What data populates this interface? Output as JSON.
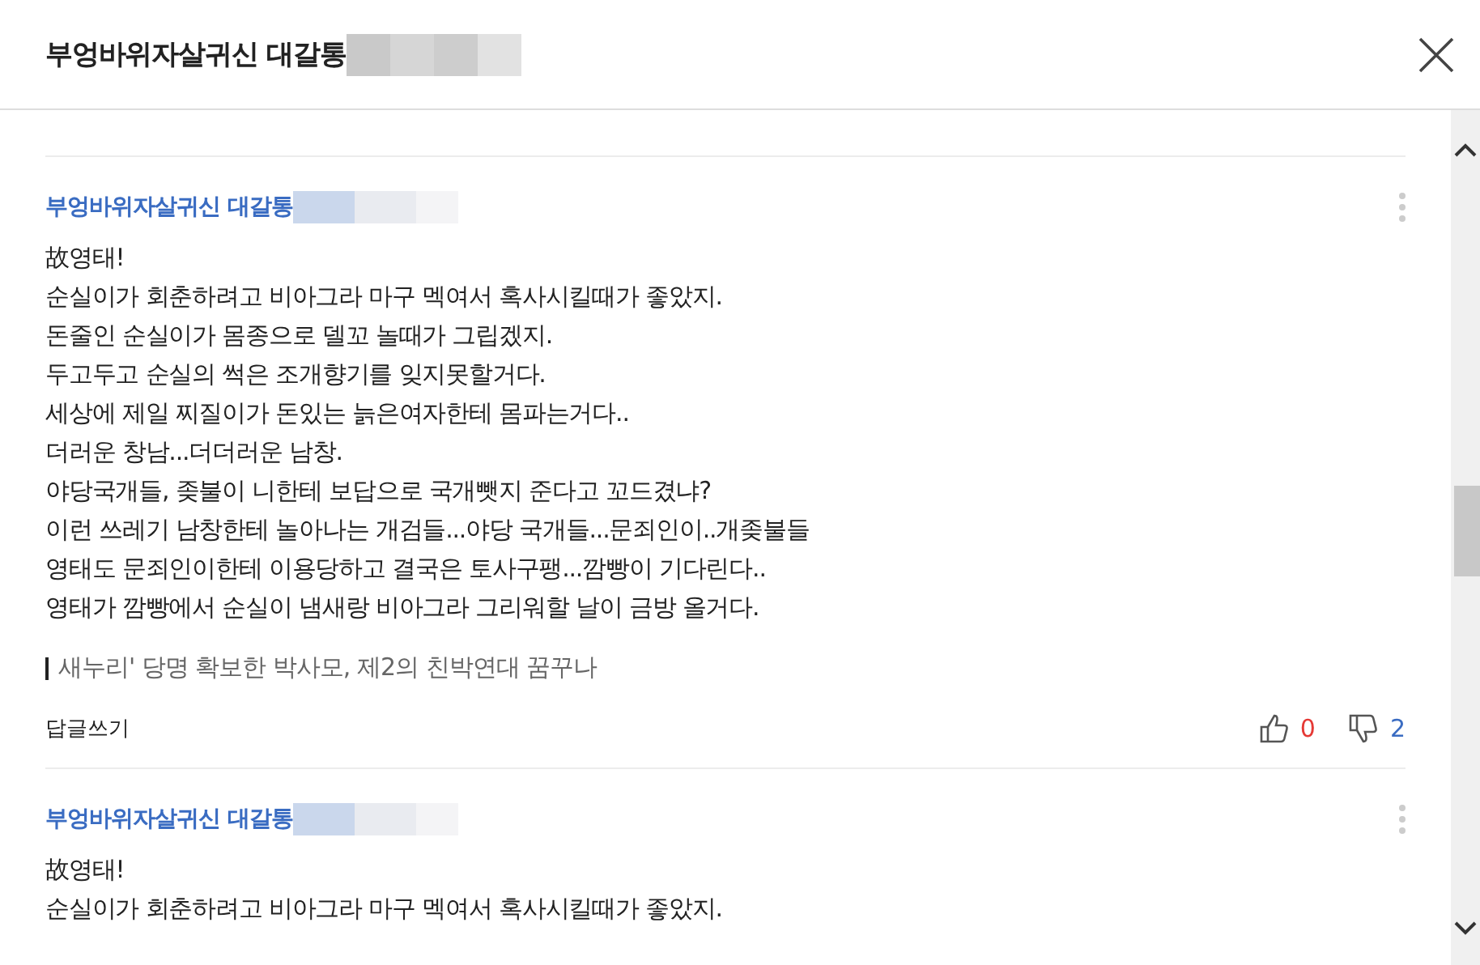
{
  "window": {
    "title": "부엉바위자살귀신 대갈통"
  },
  "comments": [
    {
      "author": "부엉바위자살귀신 대갈통",
      "body_lines": [
        "故영태!",
        "순실이가 회춘하려고 비아그라 마구 멕여서 혹사시킬때가 좋았지.",
        "돈줄인 순실이가 몸종으로 델꼬 놀때가 그립겠지.",
        "두고두고 순실의 썩은 조개향기를 잊지못할거다.",
        "세상에 제일 찌질이가 돈있는 늙은여자한테 몸파는거다..",
        "더러운 창남...더더러운 남창.",
        "야당국개들, 좆불이 니한테 보답으로 국개뺏지 준다고 꼬드겼냐?",
        "이런 쓰레기 남창한테 놀아나는 개검들...야당 국개들...문죄인이..개좆불들",
        "영태도 문죄인이한테 이용당하고 결국은 토사구팽...깜빵이 기다린다..",
        "영태가 깜빵에서 순실이 냄새랑 비아그라 그리워할 날이 금방 올거다."
      ],
      "quote": "새누리' 당명 확보한 박사모, 제2의 친박연대 꿈꾸나",
      "reply_label": "답글쓰기",
      "likes": "0",
      "dislikes": "2"
    },
    {
      "author": "부엉바위자살귀신 대갈통",
      "body_lines": [
        "故영태!",
        "순실이가 회춘하려고 비아그라 마구 멕여서 혹사시킬때가 좋았지."
      ]
    }
  ]
}
